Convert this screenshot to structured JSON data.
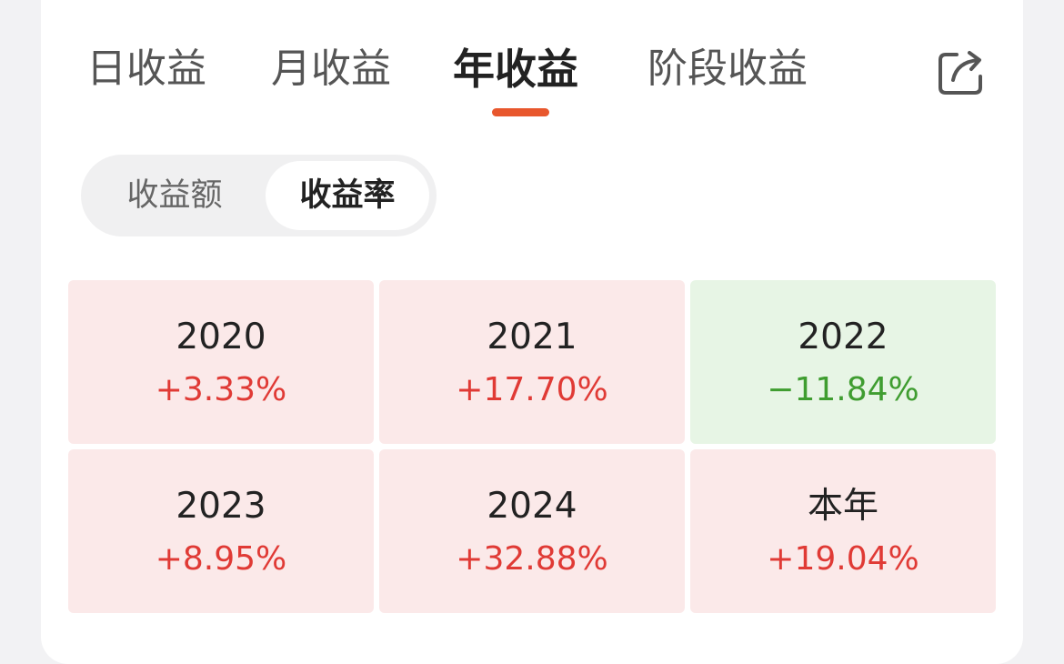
{
  "tabs": [
    {
      "label": "日收益"
    },
    {
      "label": "月收益"
    },
    {
      "label": "年收益",
      "active": true
    },
    {
      "label": "阶段收益"
    }
  ],
  "toggle": {
    "options": [
      "收益额",
      "收益率"
    ],
    "selected": "收益率"
  },
  "returns": [
    {
      "year": "2020",
      "value": "+3.33%",
      "trend": "up"
    },
    {
      "year": "2021",
      "value": "+17.70%",
      "trend": "up"
    },
    {
      "year": "2022",
      "value": "−11.84%",
      "trend": "down"
    },
    {
      "year": "2023",
      "value": "+8.95%",
      "trend": "up"
    },
    {
      "year": "2024",
      "value": "+32.88%",
      "trend": "up"
    },
    {
      "year": "本年",
      "value": "+19.04%",
      "trend": "up"
    }
  ],
  "colors": {
    "accent": "#e8572d",
    "gain": "#e03a35",
    "gain_bg": "#fbe9e9",
    "loss": "#3f9d30",
    "loss_bg": "#e7f5e5"
  },
  "icons": {
    "share": "share-icon"
  }
}
